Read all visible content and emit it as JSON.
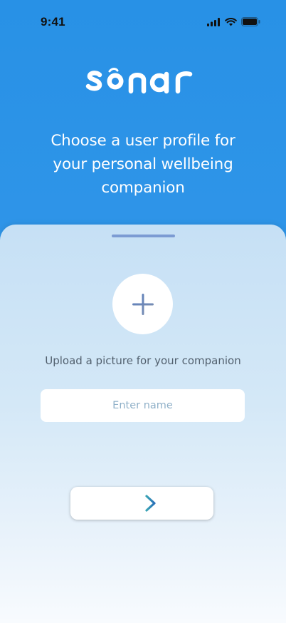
{
  "status_bar": {
    "time": "9:41",
    "icons": [
      "cellular-signal-icon",
      "wifi-icon",
      "battery-icon"
    ]
  },
  "logo": {
    "text": "sonar"
  },
  "headline": "Choose a user profile for your personal wellbeing companion",
  "sheet": {
    "upload_icon": "plus-icon",
    "upload_caption": "Upload a picture for your companion",
    "name_input": {
      "value": "",
      "placeholder": "Enter name"
    },
    "next_icon": "arrow-right-icon"
  },
  "colors": {
    "header_blue": "#2891e6",
    "sheet_top": "#c6e0f5",
    "grabber": "#7c9bd3",
    "arrow_teal": "#3ba3b8",
    "arrow_blue": "#2a6fb8"
  }
}
